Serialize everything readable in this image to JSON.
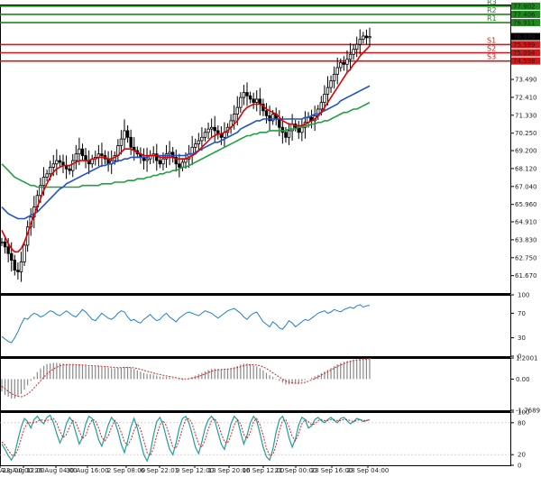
{
  "colors": {
    "candle": "#000000",
    "ma_fast": "#e00000",
    "ma_mid": "#2050d0",
    "ma_slow": "#22a040",
    "resistance": "#1a8a1a",
    "support": "#d01818",
    "rsi": "#1e7fd0",
    "macd_hist": "#888888",
    "macd_signal": "#e02020",
    "stoch_main": "#1aa0a0",
    "stoch_signal": "#e02020",
    "axis": "#000000"
  },
  "chart_data": [
    {
      "type": "candlestick",
      "panel": "price",
      "y_ticks": [
        61.67,
        62.75,
        63.83,
        64.91,
        65.96,
        67.04,
        68.12,
        69.2,
        70.25,
        71.33,
        72.41,
        73.49
      ],
      "last_price": 76.07,
      "ylim": [
        60.62,
        78.0
      ],
      "levels": [
        {
          "name": "R3",
          "value": 77.902,
          "kind": "resistance"
        },
        {
          "name": "R2",
          "value": 77.406,
          "kind": "resistance"
        },
        {
          "name": "R1",
          "value": 76.911,
          "kind": "resistance"
        },
        {
          "name": "S1",
          "value": 75.589,
          "kind": "support"
        },
        {
          "name": "S2",
          "value": 75.094,
          "kind": "support"
        },
        {
          "name": "S3",
          "value": 74.598,
          "kind": "support"
        }
      ],
      "x_labels": [
        "Aug 00:00",
        "23 Aug 12:00",
        "26 Aug 04:00",
        "30 Aug 16:00",
        "2 Sep 08:00",
        "6 Sep 22:01",
        "9 Sep 12:00",
        "13 Sep 20:00",
        "16 Sep 12:00",
        "21 Sep 00:00",
        "23 Sep 16:00",
        "28 Sep 04:00"
      ],
      "close": [
        63.7,
        63.4,
        63.0,
        62.6,
        62.0,
        61.9,
        62.5,
        63.5,
        64.6,
        65.2,
        65.8,
        66.5,
        67.1,
        67.6,
        67.8,
        68.2,
        68.4,
        68.6,
        68.5,
        68.3,
        68.1,
        68.0,
        68.6,
        69.0,
        69.3,
        68.9,
        68.6,
        68.4,
        68.7,
        68.8,
        69.0,
        68.9,
        68.7,
        68.4,
        68.6,
        68.9,
        69.5,
        69.9,
        70.4,
        70.0,
        69.4,
        69.2,
        69.0,
        68.8,
        68.6,
        68.7,
        68.9,
        69.0,
        68.6,
        68.4,
        68.7,
        69.0,
        69.1,
        68.8,
        68.4,
        68.2,
        68.5,
        68.7,
        69.0,
        69.4,
        69.6,
        69.8,
        70.0,
        70.3,
        70.5,
        70.6,
        70.4,
        70.2,
        70.0,
        70.3,
        70.6,
        71.0,
        71.4,
        71.8,
        72.4,
        72.7,
        72.5,
        72.3,
        72.1,
        72.3,
        72.0,
        71.6,
        71.3,
        71.0,
        71.4,
        71.1,
        70.6,
        70.3,
        70.0,
        70.4,
        70.8,
        70.6,
        70.3,
        70.6,
        70.9,
        71.2,
        71.0,
        71.3,
        71.7,
        72.1,
        72.6,
        73.0,
        73.4,
        73.8,
        74.2,
        74.5,
        74.4,
        74.7,
        75.0,
        75.3,
        75.6,
        75.9,
        76.1,
        76.0,
        76.07
      ],
      "ma_fast": [
        64.4,
        64.0,
        63.6,
        63.3,
        63.1,
        63.1,
        63.3,
        63.7,
        64.2,
        64.8,
        65.3,
        65.8,
        66.3,
        66.8,
        67.2,
        67.6,
        67.9,
        68.1,
        68.2,
        68.3,
        68.3,
        68.3,
        68.4,
        68.5,
        68.6,
        68.6,
        68.6,
        68.6,
        68.7,
        68.7,
        68.8,
        68.8,
        68.8,
        68.7,
        68.7,
        68.8,
        68.9,
        69.1,
        69.3,
        69.3,
        69.3,
        69.2,
        69.1,
        69.0,
        68.9,
        68.9,
        68.9,
        68.9,
        68.9,
        68.8,
        68.8,
        68.8,
        68.8,
        68.8,
        68.7,
        68.7,
        68.7,
        68.7,
        68.8,
        68.9,
        69.0,
        69.2,
        69.4,
        69.6,
        69.8,
        70.0,
        70.1,
        70.2,
        70.2,
        70.3,
        70.4,
        70.6,
        70.8,
        71.0,
        71.3,
        71.6,
        71.8,
        71.9,
        72.0,
        72.0,
        72.0,
        71.9,
        71.7,
        71.6,
        71.5,
        71.4,
        71.2,
        71.0,
        70.9,
        70.8,
        70.8,
        70.7,
        70.7,
        70.7,
        70.8,
        70.9,
        71.0,
        71.1,
        71.3,
        71.5,
        71.8,
        72.1,
        72.4,
        72.7,
        73.0,
        73.3,
        73.6,
        73.9,
        74.1,
        74.4,
        74.6,
        74.9,
        75.1,
        75.3,
        75.5
      ],
      "ma_mid": [
        65.8,
        65.6,
        65.4,
        65.3,
        65.2,
        65.1,
        65.1,
        65.1,
        65.2,
        65.3,
        65.4,
        65.5,
        65.7,
        65.9,
        66.1,
        66.3,
        66.5,
        66.7,
        66.9,
        67.0,
        67.2,
        67.3,
        67.4,
        67.5,
        67.6,
        67.7,
        67.8,
        67.9,
        68.0,
        68.1,
        68.2,
        68.3,
        68.3,
        68.4,
        68.4,
        68.5,
        68.6,
        68.6,
        68.7,
        68.7,
        68.8,
        68.8,
        68.8,
        68.8,
        68.8,
        68.8,
        68.9,
        68.9,
        68.9,
        68.9,
        68.9,
        68.9,
        68.9,
        68.9,
        68.9,
        68.9,
        68.9,
        68.9,
        69.0,
        69.0,
        69.1,
        69.2,
        69.3,
        69.4,
        69.5,
        69.6,
        69.7,
        69.7,
        69.8,
        69.9,
        70.0,
        70.1,
        70.2,
        70.3,
        70.5,
        70.6,
        70.7,
        70.8,
        70.9,
        71.0,
        71.0,
        71.1,
        71.1,
        71.1,
        71.1,
        71.1,
        71.1,
        71.1,
        71.1,
        71.1,
        71.1,
        71.1,
        71.1,
        71.1,
        71.2,
        71.2,
        71.3,
        71.4,
        71.4,
        71.5,
        71.6,
        71.7,
        71.8,
        71.9,
        72.0,
        72.2,
        72.3,
        72.4,
        72.5,
        72.6,
        72.7,
        72.8,
        72.9,
        73.0,
        73.1
      ],
      "ma_slow": [
        68.4,
        68.2,
        68.0,
        67.8,
        67.6,
        67.5,
        67.4,
        67.3,
        67.2,
        67.1,
        67.1,
        67.0,
        67.0,
        67.0,
        67.0,
        67.0,
        67.0,
        67.0,
        67.0,
        67.0,
        67.0,
        67.0,
        67.0,
        67.0,
        67.0,
        67.1,
        67.1,
        67.1,
        67.1,
        67.1,
        67.1,
        67.2,
        67.2,
        67.2,
        67.2,
        67.3,
        67.3,
        67.3,
        67.3,
        67.4,
        67.4,
        67.4,
        67.5,
        67.5,
        67.5,
        67.6,
        67.6,
        67.7,
        67.7,
        67.8,
        67.8,
        67.9,
        67.9,
        68.0,
        68.0,
        68.1,
        68.2,
        68.2,
        68.3,
        68.4,
        68.5,
        68.6,
        68.7,
        68.8,
        68.9,
        69.0,
        69.1,
        69.2,
        69.3,
        69.4,
        69.5,
        69.6,
        69.7,
        69.8,
        69.9,
        70.0,
        70.1,
        70.1,
        70.2,
        70.2,
        70.3,
        70.3,
        70.3,
        70.4,
        70.4,
        70.4,
        70.4,
        70.4,
        70.4,
        70.5,
        70.5,
        70.5,
        70.6,
        70.6,
        70.7,
        70.7,
        70.8,
        70.8,
        70.9,
        70.9,
        71.0,
        71.0,
        71.1,
        71.2,
        71.3,
        71.4,
        71.5,
        71.5,
        71.6,
        71.7,
        71.7,
        71.8,
        71.9,
        72.0,
        72.1
      ]
    },
    {
      "type": "line",
      "panel": "rsi",
      "y_ticks": [
        100,
        70,
        30,
        0
      ],
      "ylim": [
        0,
        100
      ],
      "values": [
        32,
        28,
        24,
        22,
        30,
        40,
        52,
        62,
        60,
        66,
        70,
        68,
        64,
        66,
        70,
        74,
        72,
        68,
        66,
        70,
        74,
        70,
        66,
        64,
        70,
        76,
        72,
        66,
        60,
        58,
        64,
        70,
        66,
        62,
        60,
        64,
        70,
        74,
        72,
        64,
        58,
        60,
        56,
        54,
        60,
        64,
        68,
        62,
        58,
        60,
        66,
        70,
        64,
        60,
        56,
        62,
        66,
        70,
        72,
        70,
        68,
        66,
        70,
        74,
        72,
        70,
        66,
        62,
        66,
        70,
        74,
        76,
        78,
        74,
        70,
        64,
        60,
        66,
        70,
        72,
        64,
        56,
        52,
        48,
        56,
        52,
        46,
        44,
        50,
        58,
        54,
        48,
        52,
        56,
        60,
        58,
        62,
        66,
        70,
        72,
        74,
        70,
        72,
        76,
        74,
        72,
        76,
        78,
        80,
        78,
        82,
        84,
        80,
        82,
        83
      ]
    },
    {
      "type": "macd",
      "panel": "macd",
      "y_ticks": [
        1.2001,
        0.0,
        -1.7689
      ],
      "ylim": [
        -1.7689,
        1.2001
      ],
      "histogram": [
        -0.7,
        -0.9,
        -1.0,
        -1.1,
        -1.1,
        -1.0,
        -0.85,
        -0.6,
        -0.35,
        -0.1,
        0.15,
        0.4,
        0.6,
        0.75,
        0.85,
        0.9,
        0.92,
        0.92,
        0.9,
        0.88,
        0.85,
        0.82,
        0.8,
        0.8,
        0.8,
        0.78,
        0.75,
        0.72,
        0.72,
        0.72,
        0.72,
        0.7,
        0.68,
        0.65,
        0.62,
        0.62,
        0.64,
        0.66,
        0.7,
        0.7,
        0.65,
        0.58,
        0.5,
        0.42,
        0.35,
        0.3,
        0.28,
        0.25,
        0.2,
        0.15,
        0.12,
        0.12,
        0.1,
        0.05,
        0.0,
        -0.05,
        -0.05,
        0.0,
        0.05,
        0.12,
        0.2,
        0.28,
        0.36,
        0.44,
        0.52,
        0.58,
        0.6,
        0.58,
        0.55,
        0.55,
        0.58,
        0.62,
        0.68,
        0.74,
        0.82,
        0.88,
        0.88,
        0.84,
        0.78,
        0.72,
        0.62,
        0.5,
        0.36,
        0.22,
        0.12,
        0.02,
        -0.1,
        -0.2,
        -0.3,
        -0.3,
        -0.26,
        -0.24,
        -0.22,
        -0.14,
        -0.06,
        0.02,
        0.08,
        0.16,
        0.24,
        0.34,
        0.44,
        0.54,
        0.64,
        0.74,
        0.84,
        0.92,
        0.98,
        1.02,
        1.06,
        1.1,
        1.12,
        1.15,
        1.17,
        1.18,
        1.2
      ],
      "signal": [
        -0.4,
        -0.55,
        -0.7,
        -0.82,
        -0.92,
        -0.98,
        -1.0,
        -0.95,
        -0.85,
        -0.7,
        -0.5,
        -0.3,
        -0.1,
        0.1,
        0.3,
        0.45,
        0.58,
        0.68,
        0.75,
        0.8,
        0.82,
        0.83,
        0.83,
        0.82,
        0.81,
        0.8,
        0.79,
        0.77,
        0.76,
        0.75,
        0.74,
        0.73,
        0.72,
        0.7,
        0.68,
        0.66,
        0.65,
        0.65,
        0.66,
        0.67,
        0.66,
        0.64,
        0.6,
        0.56,
        0.5,
        0.45,
        0.4,
        0.35,
        0.3,
        0.26,
        0.22,
        0.18,
        0.15,
        0.12,
        0.08,
        0.05,
        0.02,
        0.01,
        0.02,
        0.05,
        0.1,
        0.15,
        0.22,
        0.3,
        0.38,
        0.45,
        0.5,
        0.53,
        0.55,
        0.56,
        0.57,
        0.59,
        0.62,
        0.66,
        0.71,
        0.76,
        0.8,
        0.82,
        0.82,
        0.8,
        0.76,
        0.7,
        0.6,
        0.48,
        0.36,
        0.24,
        0.12,
        0.0,
        -0.1,
        -0.18,
        -0.22,
        -0.24,
        -0.24,
        -0.22,
        -0.18,
        -0.12,
        -0.05,
        0.03,
        0.12,
        0.22,
        0.32,
        0.42,
        0.52,
        0.62,
        0.72,
        0.8,
        0.88,
        0.95,
        1.0,
        1.05,
        1.08,
        1.1,
        1.12,
        1.14,
        1.15
      ]
    },
    {
      "type": "line",
      "panel": "stochastic",
      "y_ticks": [
        100,
        80,
        20,
        0
      ],
      "ylim": [
        0,
        100
      ],
      "main": [
        40,
        30,
        18,
        10,
        22,
        48,
        72,
        88,
        82,
        70,
        86,
        92,
        84,
        78,
        90,
        94,
        80,
        60,
        42,
        55,
        78,
        90,
        82,
        60,
        40,
        52,
        78,
        92,
        88,
        70,
        48,
        36,
        54,
        76,
        90,
        82,
        64,
        40,
        24,
        46,
        72,
        88,
        70,
        44,
        20,
        8,
        24,
        56,
        82,
        90,
        76,
        52,
        30,
        20,
        42,
        70,
        88,
        92,
        80,
        58,
        34,
        22,
        44,
        70,
        86,
        92,
        84,
        62,
        40,
        30,
        52,
        78,
        92,
        86,
        62,
        40,
        56,
        80,
        92,
        84,
        60,
        34,
        16,
        10,
        30,
        62,
        86,
        92,
        78,
        52,
        34,
        50,
        76,
        90,
        86,
        70,
        74,
        86,
        90,
        84,
        80,
        86,
        90,
        84,
        80,
        88,
        90,
        84,
        78,
        82,
        88,
        86,
        82,
        84,
        86
      ],
      "signal": [
        44,
        38,
        28,
        20,
        18,
        30,
        50,
        70,
        80,
        80,
        80,
        82,
        86,
        84,
        84,
        86,
        88,
        80,
        64,
        52,
        58,
        72,
        84,
        80,
        64,
        50,
        56,
        74,
        86,
        84,
        70,
        52,
        46,
        56,
        72,
        84,
        78,
        62,
        44,
        38,
        48,
        66,
        78,
        68,
        46,
        24,
        18,
        32,
        56,
        76,
        84,
        74,
        54,
        34,
        32,
        48,
        70,
        86,
        88,
        78,
        58,
        40,
        34,
        48,
        68,
        84,
        88,
        78,
        60,
        44,
        42,
        56,
        76,
        86,
        78,
        58,
        50,
        62,
        82,
        88,
        76,
        56,
        32,
        18,
        20,
        38,
        64,
        84,
        86,
        72,
        54,
        46,
        60,
        78,
        86,
        82,
        76,
        78,
        84,
        86,
        84,
        84,
        86,
        86,
        84,
        84,
        86,
        86,
        84,
        82,
        84,
        86,
        84,
        84,
        85
      ],
      "fill": "#1aa0a0"
    }
  ]
}
